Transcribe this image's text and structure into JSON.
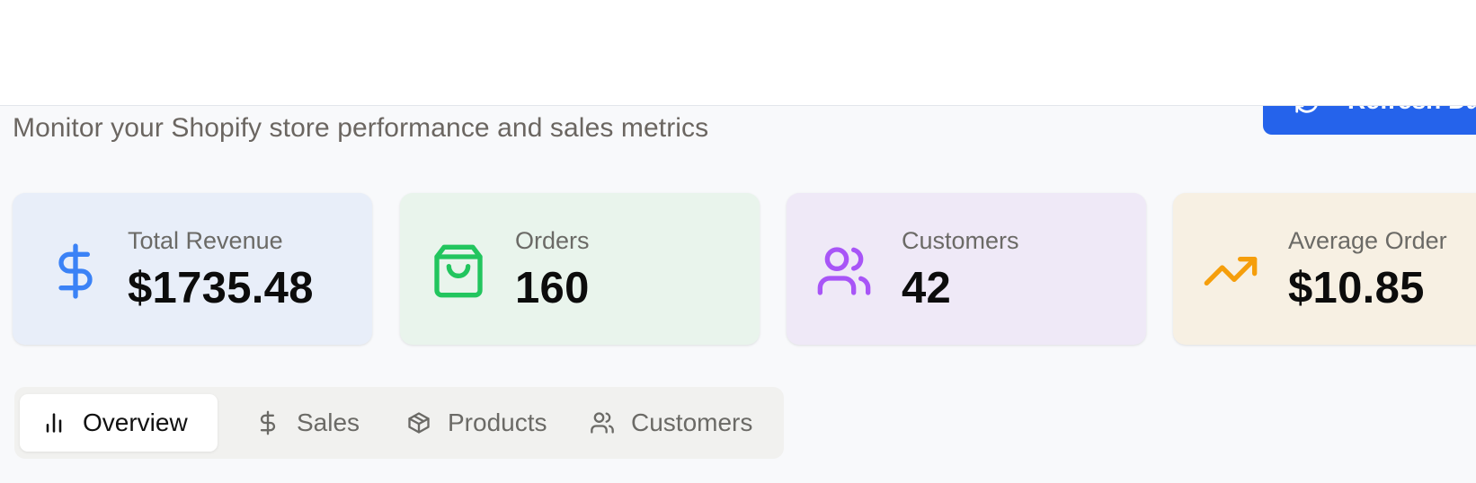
{
  "header": {
    "subtitle": "Monitor your Shopify store performance and sales metrics",
    "refresh_label": "Refresh Da"
  },
  "stats": [
    {
      "label": "Total Revenue",
      "value": "$1735.48",
      "icon": "dollar-icon",
      "color": "#3b82f6"
    },
    {
      "label": "Orders",
      "value": "160",
      "icon": "shopping-bag-icon",
      "color": "#22c55e"
    },
    {
      "label": "Customers",
      "value": "42",
      "icon": "users-icon",
      "color": "#a855f7"
    },
    {
      "label": "Average Order",
      "value": "$10.85",
      "icon": "trending-up-icon",
      "color": "#f59e0b"
    }
  ],
  "tabs": [
    {
      "label": "Overview",
      "icon": "bar-chart-icon",
      "active": true
    },
    {
      "label": "Sales",
      "icon": "dollar-icon",
      "active": false
    },
    {
      "label": "Products",
      "icon": "package-icon",
      "active": false
    },
    {
      "label": "Customers",
      "icon": "users-icon",
      "active": false
    }
  ],
  "colors": {
    "accent": "#2563eb",
    "background": "#f8f9fb"
  }
}
